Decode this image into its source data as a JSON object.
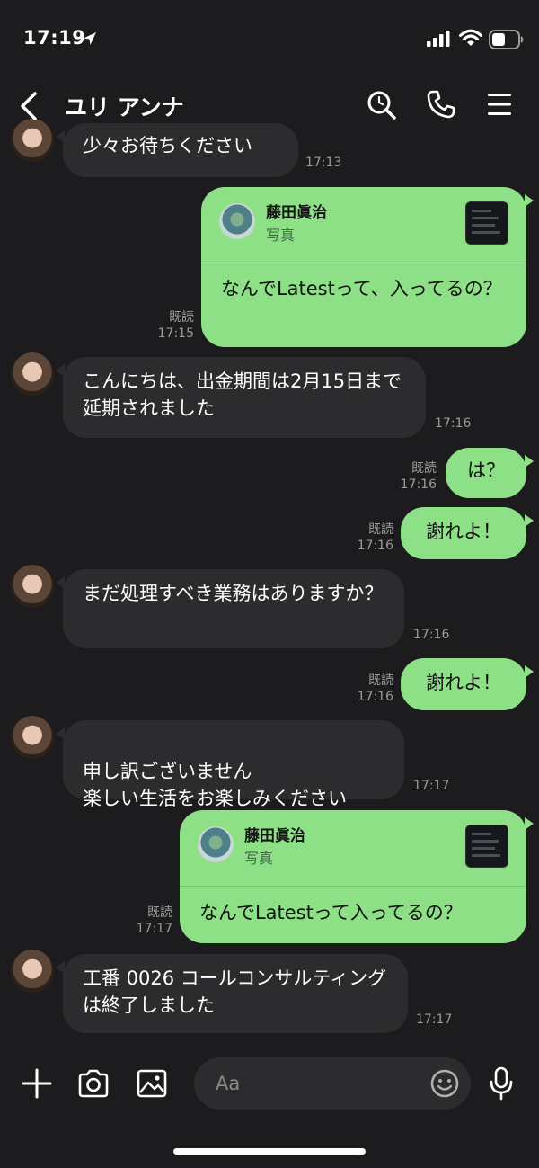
{
  "status_bar": {
    "time": "17:19"
  },
  "header": {
    "title": "ユリ アンナ"
  },
  "messages": [
    {
      "side": "in",
      "text": "少々お待ちください",
      "time": "17:13"
    },
    {
      "side": "out",
      "quote": {
        "name": "藤田眞治",
        "type": "写真"
      },
      "text": "なんでLatestって、入ってるの？",
      "read": "既読",
      "time": "17:15"
    },
    {
      "side": "in",
      "text": "こんにちは、出金期間は2月15日まで延期されました",
      "time": "17:16"
    },
    {
      "side": "out",
      "text": "は？",
      "read": "既読",
      "time": "17:16"
    },
    {
      "side": "out",
      "text": "謝れよ！",
      "read": "既読",
      "time": "17:16"
    },
    {
      "side": "in",
      "text": "まだ処理すべき業務はありますか？",
      "time": "17:16"
    },
    {
      "side": "out",
      "text": "謝れよ！",
      "read": "既読",
      "time": "17:16"
    },
    {
      "side": "in",
      "text": "申し訳ございません\n楽しい生活をお楽しみください",
      "time": "17:17"
    },
    {
      "side": "out",
      "quote": {
        "name": "藤田眞治",
        "type": "写真"
      },
      "text": "なんでLatestって入ってるの？",
      "read": "既読",
      "time": "17:17"
    },
    {
      "side": "in",
      "text": " 工番 0026 コールコンサルティングは終了しました",
      "time": "17:17"
    }
  ],
  "composer": {
    "placeholder": "Aa"
  },
  "icons": [
    "location-arrow-icon",
    "signal-icon",
    "wifi-icon",
    "battery-icon",
    "back-chevron-icon",
    "search-icon",
    "phone-icon",
    "menu-icon",
    "plus-icon",
    "camera-icon",
    "image-icon",
    "emoji-icon",
    "mic-icon"
  ]
}
